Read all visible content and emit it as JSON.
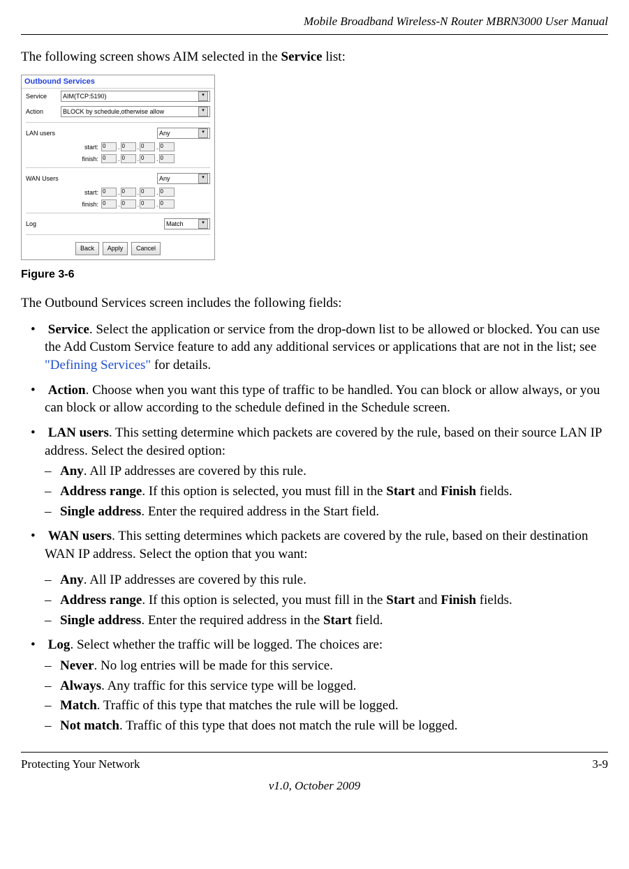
{
  "header_title": "Mobile Broadband Wireless-N Router MBRN3000 User Manual",
  "intro_prefix": "The following screen shows AIM selected in the ",
  "intro_bold": "Service",
  "intro_suffix": " list:",
  "screenshot": {
    "title": "Outbound Services",
    "service_label": "Service",
    "service_value": "AIM(TCP:5190)",
    "action_label": "Action",
    "action_value": "BLOCK by schedule,otherwise allow",
    "lan_label": "LAN users",
    "lan_value": "Any",
    "wan_label": "WAN Users",
    "wan_value": "Any",
    "start_label": "start:",
    "finish_label": "finish:",
    "ip_octet": "0",
    "log_label": "Log",
    "log_value": "Match",
    "back_btn": "Back",
    "apply_btn": "Apply",
    "cancel_btn": "Cancel"
  },
  "figure_caption": "Figure 3-6",
  "outbound_intro": "The Outbound Services screen includes the following fields:",
  "items": {
    "service": {
      "label": "Service",
      "text1": ". Select the application or service from the drop-down list to be allowed or blocked. You can use the Add Custom Service feature to add any additional services or applications that are not in the list; see ",
      "link": "\"Defining Services\"",
      "text2": " for details."
    },
    "action": {
      "label": "Action",
      "text": ". Choose when you want this type of traffic to be handled. You can block or allow always, or you can block or allow according to the schedule defined in the Schedule screen."
    },
    "lan": {
      "label": "LAN users",
      "text": ". This setting determine which packets are covered by the rule, based on their source LAN IP address. Select the desired option:",
      "sub": {
        "any_label": "Any",
        "any_text": ". All IP addresses are covered by this rule.",
        "range_label": "Address range",
        "range_text1": ". If this option is selected, you must fill in the ",
        "range_start": "Start",
        "range_and": " and ",
        "range_finish": "Finish",
        "range_text2": " fields.",
        "single_label": "Single address",
        "single_text": ". Enter the required address in the Start field."
      }
    },
    "wan": {
      "label": "WAN users",
      "text": ". This setting determines which packets are covered by the rule, based on their destination WAN IP address. Select the option that you want:",
      "sub": {
        "any_label": "Any",
        "any_text": ". All IP addresses are covered by this rule.",
        "range_label": "Address range",
        "range_text1": ". If this option is selected, you must fill in the ",
        "range_start": "Start",
        "range_and": " and ",
        "range_finish": "Finish",
        "range_text2": " fields.",
        "single_label": "Single address",
        "single_text1": ". Enter the required address in the ",
        "single_start": "Start",
        "single_text2": " field."
      }
    },
    "log": {
      "label": "Log",
      "text": ". Select whether the traffic will be logged. The choices are:",
      "sub": {
        "never_label": "Never",
        "never_text": ". No log entries will be made for this service.",
        "always_label": "Always",
        "always_text": ". Any traffic for this service type will be logged.",
        "match_label": "Match",
        "match_text": ". Traffic of this type that matches the rule will be logged.",
        "notmatch_label": "Not match",
        "notmatch_text": ". Traffic of this type that does not match the rule will be logged."
      }
    }
  },
  "footer": {
    "left": "Protecting Your Network",
    "right": "3-9",
    "center": "v1.0, October 2009"
  }
}
